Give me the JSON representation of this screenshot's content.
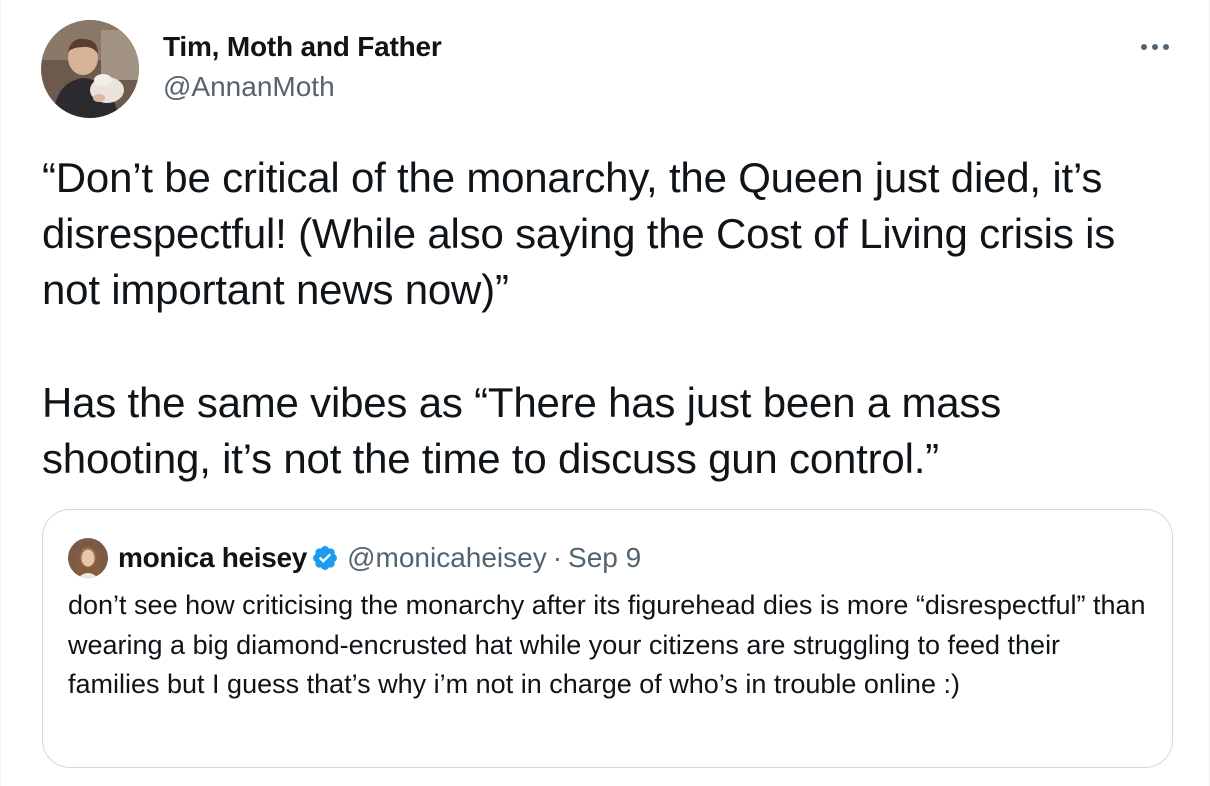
{
  "author": {
    "name": "Tim, Moth and Father",
    "handle": "@AnnanMoth"
  },
  "more_icon": "more-horizontal-icon",
  "tweet": {
    "paragraphs": [
      "“Don’t be critical of the monarchy, the Queen just died, it’s disrespectful! (While also saying the Cost of Living crisis is not important news now)”",
      "Has the same vibes as “There has just been a mass shooting, it’s not the time to discuss gun control.”"
    ]
  },
  "quote": {
    "name": "monica heisey",
    "verified_icon": "verified-badge-icon",
    "handle": "@monicaheisey",
    "separator": "·",
    "date": "Sep 9",
    "text": "don’t see how criticising the monarchy after its figurehead dies is more “disrespectful” than wearing a big diamond-encrusted hat while your citizens are struggling to feed their families but I guess that’s why i’m not in charge of who’s in trouble online :)"
  },
  "colors": {
    "text": "#0f1419",
    "secondary": "#536471",
    "border": "#cfd9de",
    "verified": "#1d9bf0"
  }
}
